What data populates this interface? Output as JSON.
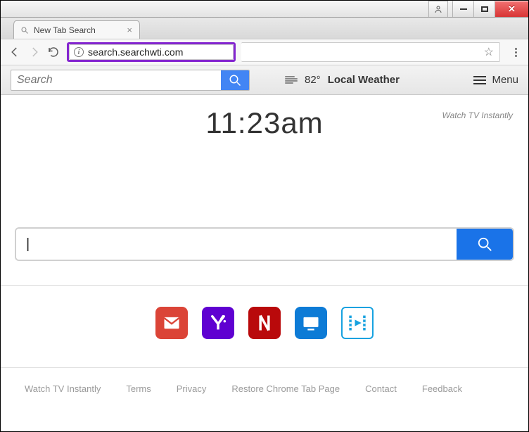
{
  "window": {
    "tab_title": "New Tab Search",
    "url": "search.searchwti.com"
  },
  "toolbar": {
    "search_placeholder": "Search",
    "weather_temp": "82°",
    "weather_label": "Local Weather",
    "menu_label": "Menu"
  },
  "hero": {
    "clock": "11:23am",
    "tagline": "Watch TV Instantly"
  },
  "big_search": {
    "value": "",
    "cursor": "|"
  },
  "tiles": [
    {
      "name": "gmail",
      "label": "Gmail"
    },
    {
      "name": "yahoo",
      "label": "Yahoo"
    },
    {
      "name": "netflix",
      "label": "Netflix"
    },
    {
      "name": "tv",
      "label": "TV"
    },
    {
      "name": "video",
      "label": "Video"
    }
  ],
  "footer": {
    "links": [
      "Watch TV Instantly",
      "Terms",
      "Privacy",
      "Restore Chrome Tab Page",
      "Contact",
      "Feedback"
    ]
  }
}
